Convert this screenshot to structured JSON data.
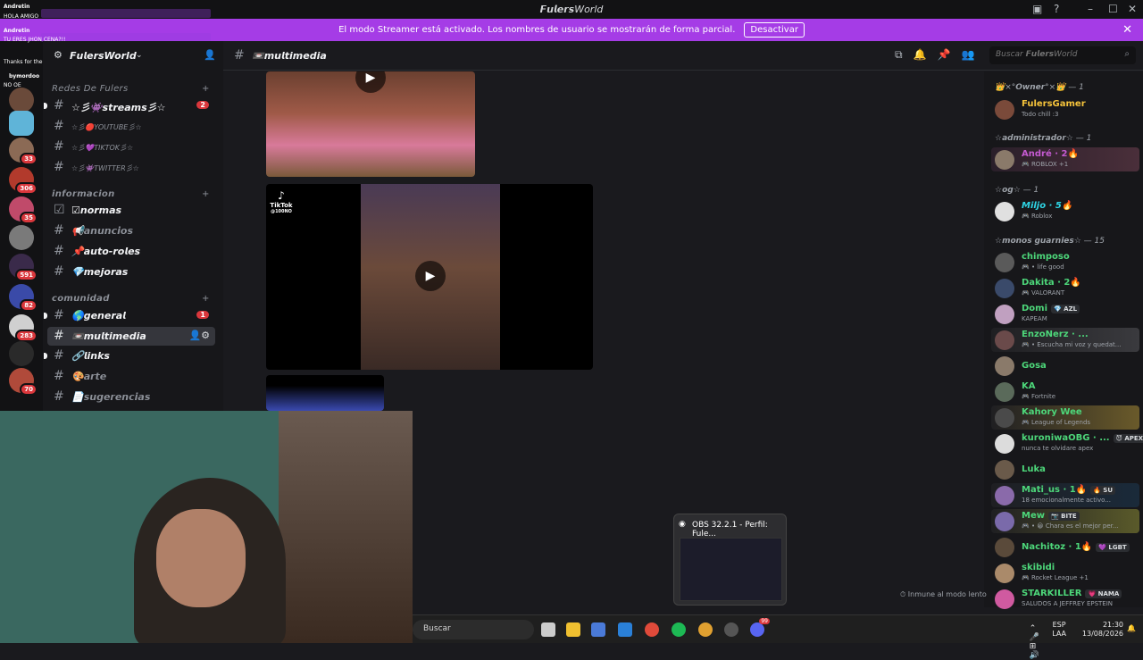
{
  "window": {
    "title": "𝙁𝙪𝙡𝙚𝙧𝙨World"
  },
  "banner": {
    "text": "El modo Streamer está activado. Los nombres de usuario se mostrarán de forma parcial.",
    "button": "Desactivar",
    "bg": "#a53ce6"
  },
  "chat_overlay": [
    {
      "user": "Andretin",
      "msg": "HOLA AMIGO"
    },
    {
      "user": "Andretin",
      "msg": "TU ERES JHON CENA?!!"
    },
    {
      "user": "",
      "msg": "Thanks for the follow @bymordoo"
    },
    {
      "user": "bymordoo",
      "msg": "NO OE"
    }
  ],
  "server": {
    "name": "𝙁𝙪𝙡𝙚𝙧𝙨World"
  },
  "server_badges": [
    "33",
    "306",
    "35",
    "591",
    "82",
    "283",
    "70"
  ],
  "categories": [
    {
      "label": "Redes De Fulers"
    },
    {
      "label": "𝙞𝙣𝙛𝙤𝙧𝙢𝙖𝙘𝙞𝙤𝙣"
    },
    {
      "label": "𝙘𝙤𝙢𝙪𝙣𝙞𝙙𝙖𝙙"
    }
  ],
  "channels": [
    {
      "label": "☆彡👾𝙨𝙩𝙧𝙚𝙖𝙢𝙨彡☆",
      "count": "2",
      "bold": true
    },
    {
      "label": "☆彡🔴YOUTUBE彡☆"
    },
    {
      "label": "☆彡💜TIKTOK彡☆"
    },
    {
      "label": "☆彡👾TWITTER彡☆"
    },
    {
      "label": "☑𝙣𝙤𝙧𝙢𝙖𝙨",
      "bold": true
    },
    {
      "label": "📢𝙖𝙣𝙪𝙣𝙘𝙞𝙤𝙨"
    },
    {
      "label": "📌𝙖𝙪𝙩𝙤-𝙧𝙤𝙡𝙚𝙨",
      "bold": true
    },
    {
      "label": "💎𝙢𝙚𝙟𝙤𝙧𝙖𝙨",
      "bold": true
    },
    {
      "label": "🌎𝙜𝙚𝙣𝙚𝙧𝙖𝙡",
      "count": "1",
      "bold": true
    },
    {
      "label": "📼𝙢𝙪𝙡𝙩𝙞𝙢𝙚𝙙𝙞𝙖",
      "bold": true
    },
    {
      "label": "🔗𝙡𝙞𝙣𝙠𝙨",
      "bold": true
    },
    {
      "label": "🎨𝙖𝙧𝙩𝙚"
    },
    {
      "label": "📄𝙨𝙪𝙜𝙚𝙧𝙚𝙣𝙘𝙞𝙖𝙨"
    }
  ],
  "topbar": {
    "channel": "📼𝙢𝙪𝙡𝙩𝙞𝙢𝙚𝙙𝙞𝙖",
    "search_placeholder": "Buscar 𝙁𝙪𝙡𝙚𝙧𝙨World"
  },
  "tiktok": {
    "brand": "TikTok",
    "handle": "@100NO"
  },
  "obs_popup": {
    "title": "OBS 32.2.1 - Perfil: Fule..."
  },
  "slowmode": "Inmune al modo lento",
  "roles": [
    {
      "label": "👑×°𝙊𝙬𝙣𝙚𝙧°×👑 — 1"
    },
    {
      "label": "☆𝙖𝙙𝙢𝙞𝙣𝙞𝙨𝙩𝙧𝙖𝙙𝙤𝙧☆ — 1"
    },
    {
      "label": "☆𝙤𝙜☆ — 1"
    },
    {
      "label": "☆𝙢𝙤𝙣𝙤𝙨 𝙜𝙪𝙖𝙧𝙣𝙞𝙚𝙨☆ — 15"
    }
  ],
  "members": [
    {
      "name": "FulersGamer",
      "status": "Todo chill :3",
      "color": "#f5c33b"
    },
    {
      "name": "André · 2🔥",
      "status": "🎮 ROBLOX +1",
      "color": "#c45ad1"
    },
    {
      "name": "Miljo · 5🔥",
      "status": "🎮 Roblox",
      "color": "#2fd6e6"
    },
    {
      "name": "chimposo",
      "status": "🎮 • life good",
      "color": "#4dd77a"
    },
    {
      "name": "Dakita · 2🔥",
      "status": "🎮 VALORANT",
      "color": "#4dd77a"
    },
    {
      "name": "Domi",
      "tag": "💎 AZL",
      "status": "KAPEAM",
      "color": "#4dd77a"
    },
    {
      "name": "EnzoNerz · ...",
      "status": "🎮 • Escucha mi voz y quedat...",
      "color": "#4dd77a"
    },
    {
      "name": "Gosa",
      "status": "",
      "color": "#4dd77a"
    },
    {
      "name": "KA",
      "status": "🎮 Fortnite",
      "color": "#4dd77a"
    },
    {
      "name": "Kahory Wee",
      "status": "🎮 League of Legends",
      "color": "#4dd77a"
    },
    {
      "name": "kuroniwaOBG · ...",
      "tag": "😈 APEX",
      "status": "nunca te olvidare apex",
      "color": "#4dd77a"
    },
    {
      "name": "Luka",
      "status": "",
      "color": "#4dd77a"
    },
    {
      "name": "Mati_us · 1🔥",
      "tag": "🔥 SU",
      "status": "18 emocionalmente activo...",
      "color": "#4dd77a"
    },
    {
      "name": "Mew",
      "tag": "📷 BITE",
      "status": "🎮 • 😀 Chara es el mejor per...",
      "color": "#4dd77a"
    },
    {
      "name": "Nachitoz · 1🔥",
      "tag": "💜 LGBT",
      "status": "",
      "color": "#4dd77a"
    },
    {
      "name": "skibidi",
      "status": "🎮 Rocket League +1",
      "color": "#4dd77a"
    },
    {
      "name": "STARKILLER",
      "tag": "💗 NAMA",
      "status": "SALUDOS A JEFFREY EPSTEIN",
      "color": "#4dd77a"
    }
  ],
  "taskbar": {
    "search": "Buscar",
    "lang": "ESP",
    "layout": "LAA",
    "time": "21:30",
    "date": "13/08/2026",
    "discord_badge": "99"
  }
}
